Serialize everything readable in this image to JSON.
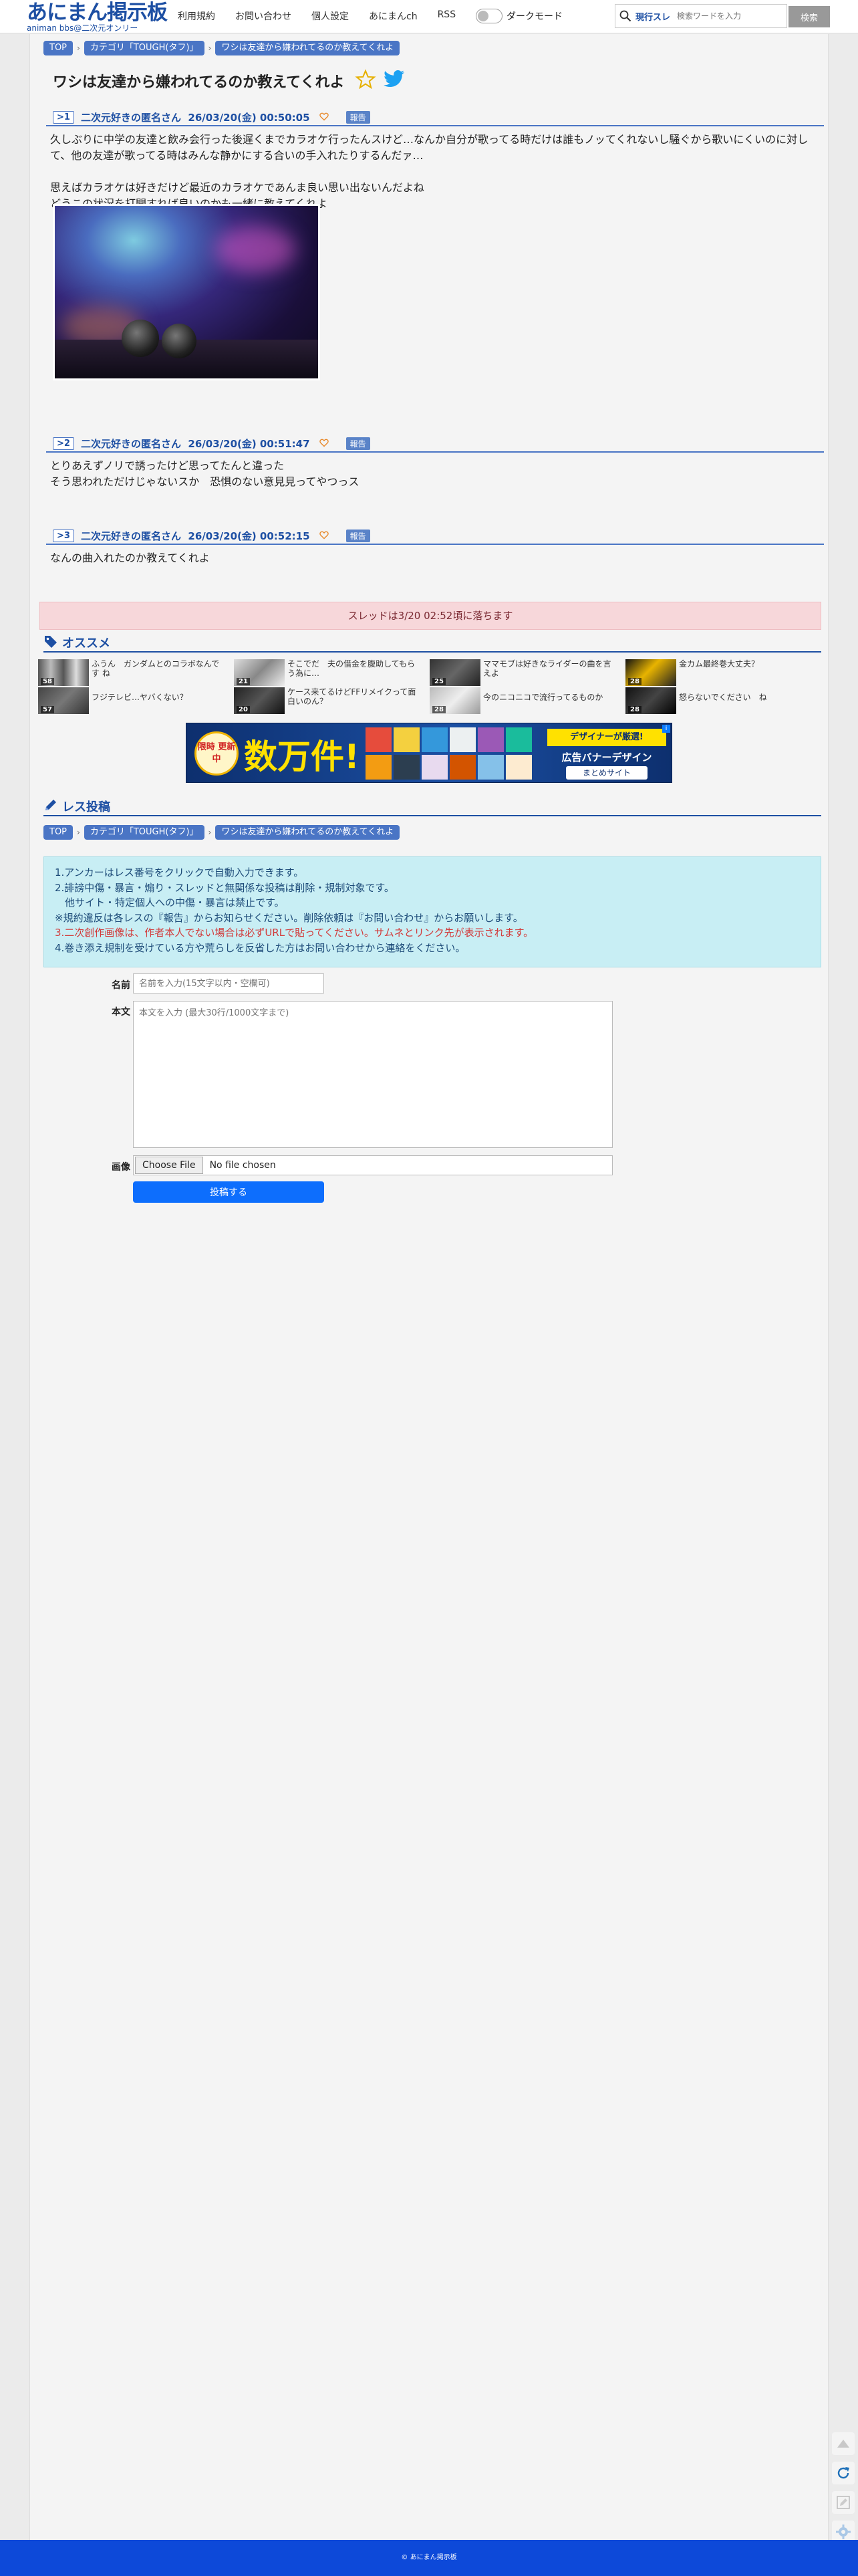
{
  "header": {
    "logo_main": "あにまん掲示板",
    "logo_sub": "animan bbs@二次元オンリー",
    "nav": [
      "利用規約",
      "お問い合わせ",
      "個人設定",
      "あにまんch",
      "RSS"
    ],
    "dark_mode_label": "ダークモード",
    "search_type": "現行スレ",
    "search_placeholder": "検索ワードを入力",
    "search_button": "検索"
  },
  "breadcrumb": [
    "TOP",
    "カテゴリ「TOUGH(タフ)」",
    "ワシは友達から嫌われてるのか教えてくれよ"
  ],
  "thread": {
    "title": "ワシは友達から嫌われてるのか教えてくれよ"
  },
  "posts": [
    {
      "no": ">1",
      "name": "二次元好きの匿名さん",
      "date": "26/03/20(金) 00:50:05",
      "report": "報告",
      "lines": [
        "久しぶりに中学の友達と飲み会行った後遅くまでカラオケ行ったんスけど…なんか自分が歌ってる時だけは誰もノッてくれないし騒ぐから歌いにくいのに対し",
        "て、他の友達が歌ってる時はみんな静かにする合いの手入れたりするんだァ…",
        "",
        "思えばカラオケは好きだけど最近のカラオケであんま良い思い出ないんだよね",
        "どうこの状況を打開すれば良いのかも一緒に教えてくれよ"
      ]
    },
    {
      "no": ">2",
      "name": "二次元好きの匿名さん",
      "date": "26/03/20(金) 00:51:47",
      "report": "報告",
      "lines": [
        "とりあえずノリで誘ったけど思ってたんと違った",
        "そう思われただけじゃないスか　恐惧のない意見見ってやつっス"
      ]
    },
    {
      "no": ">3",
      "name": "二次元好きの匿名さん",
      "date": "26/03/20(金) 00:52:15",
      "report": "報告",
      "lines": [
        "なんの曲入れたのか教えてくれよ"
      ]
    }
  ],
  "fall_notice": "スレッドは3/20 02:52頃に落ちます",
  "recommend": {
    "heading": "オススメ",
    "items": [
      {
        "title": "ふうん　ガンダムとのコラボなんです ね",
        "count": "58"
      },
      {
        "title": "そこでだ　夫の借金を腹助してもらう為に…",
        "count": "21"
      },
      {
        "title": "ママモブは好きなライダーの曲を言えよ",
        "count": "25"
      },
      {
        "title": "金カム最終巻大丈夫？",
        "count": "28"
      },
      {
        "title": "フジテレビ…ヤバくない？",
        "count": "57"
      },
      {
        "title": "ケース来てるけどFFリメイクって面白いのん？",
        "count": "20"
      },
      {
        "title": "今のニコニコで流行ってるものか",
        "count": "28"
      },
      {
        "title": "怒らないでください　ね",
        "count": "28"
      }
    ]
  },
  "ad": {
    "limited": "限時 更新中",
    "big": "数万件!",
    "ribbon": "デザイナーが厳選!",
    "tag": "広告バナーデザイン",
    "site": "まとめサイト"
  },
  "reply": {
    "heading": "レス投稿",
    "rules": [
      "1.アンカーはレス番号をクリックで自動入力できます。",
      "2.誹謗中傷・暴言・煽り・スレッドと無関係な投稿は削除・規制対象です。",
      "　他サイト・特定個人への中傷・暴言は禁止です。",
      "※規約違反は各レスの『報告』からお知らせください。削除依頼は『お問い合わせ』からお願いします。",
      "3.二次創作画像は、作者本人でない場合は必ずURLで貼ってください。サムネとリンク先が表示されます。",
      "4.巻き添え規制を受けている方や荒らしを反省した方はお問い合わせから連絡をください。"
    ],
    "name_label": "名前",
    "name_placeholder": "名前を入力(15文字以内・空欄可)",
    "body_label": "本文",
    "body_placeholder": "本文を入力 (最大30行/1000文字まで)",
    "image_label": "画像",
    "file_button": "Choose File",
    "file_none": "No file chosen",
    "submit": "投稿する"
  },
  "footer": "© あにまん掲示板",
  "colors": {
    "brand": "#1d4fa3",
    "crumb": "#4a75c5",
    "footer": "#0d49d9",
    "submit": "#0d6efd",
    "notice_bg": "#f7d7da",
    "rules_bg": "#c8eef4"
  }
}
